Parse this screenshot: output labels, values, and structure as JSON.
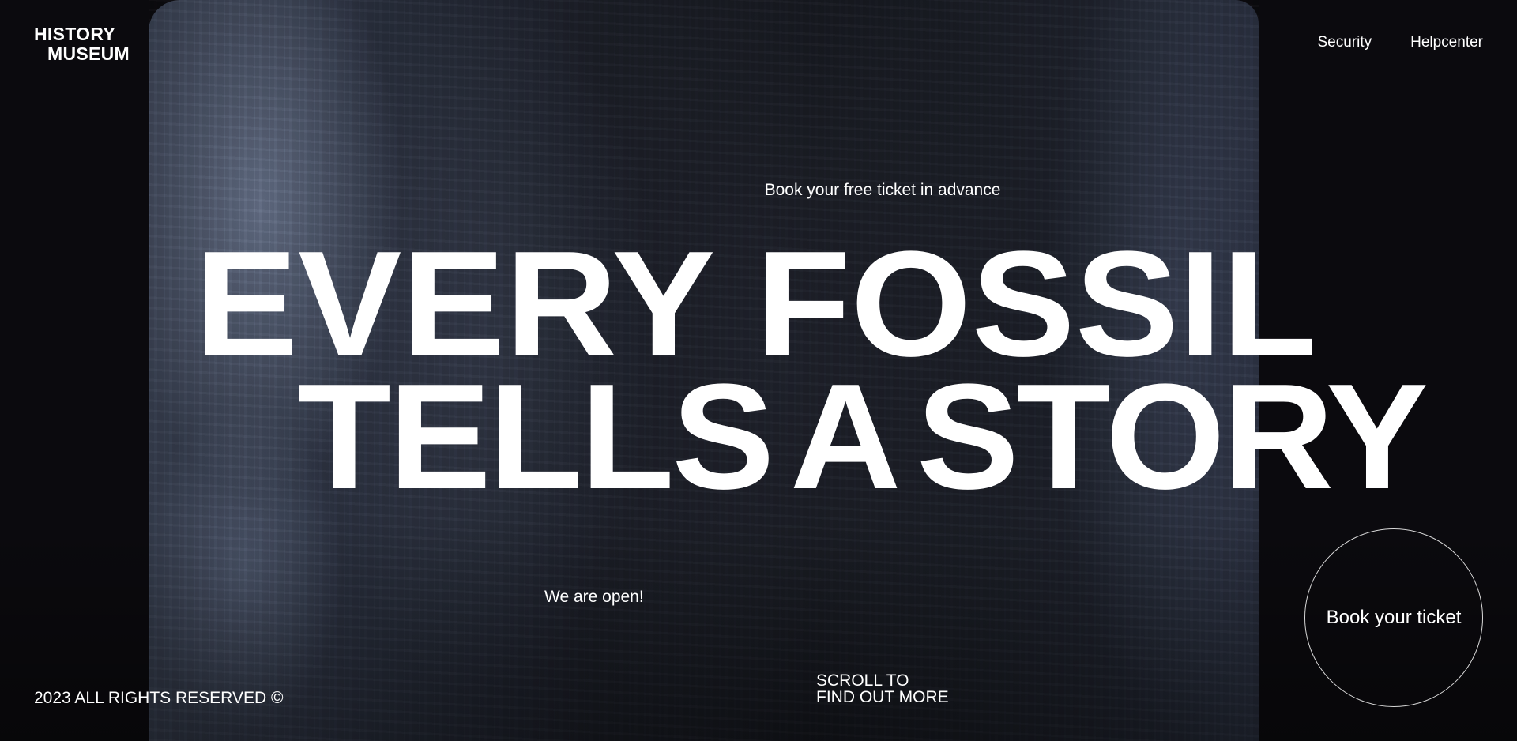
{
  "brand": {
    "line1": "HISTORY",
    "line2": "MUSEUM"
  },
  "nav": {
    "items": [
      {
        "label": "Security"
      },
      {
        "label": "Helpcenter"
      }
    ]
  },
  "hero": {
    "subheading": "Book your free ticket in advance",
    "headline_line1": "EVERY FOSSIL",
    "headline_line2_word1": "TELLS",
    "headline_line2_word2": "A",
    "headline_line2_word3": "STORY",
    "status": "We are open!"
  },
  "scroll_hint": {
    "line1": "SCROLL TO",
    "line2": "FIND OUT MORE"
  },
  "footer": {
    "copyright": "2023 ALL RIGHTS RESERVED ©"
  },
  "cta": {
    "label": "Book your ticket"
  },
  "colors": {
    "background": "#0b0a0e",
    "text": "#ffffff",
    "circle_border": "#d8d8d8"
  }
}
